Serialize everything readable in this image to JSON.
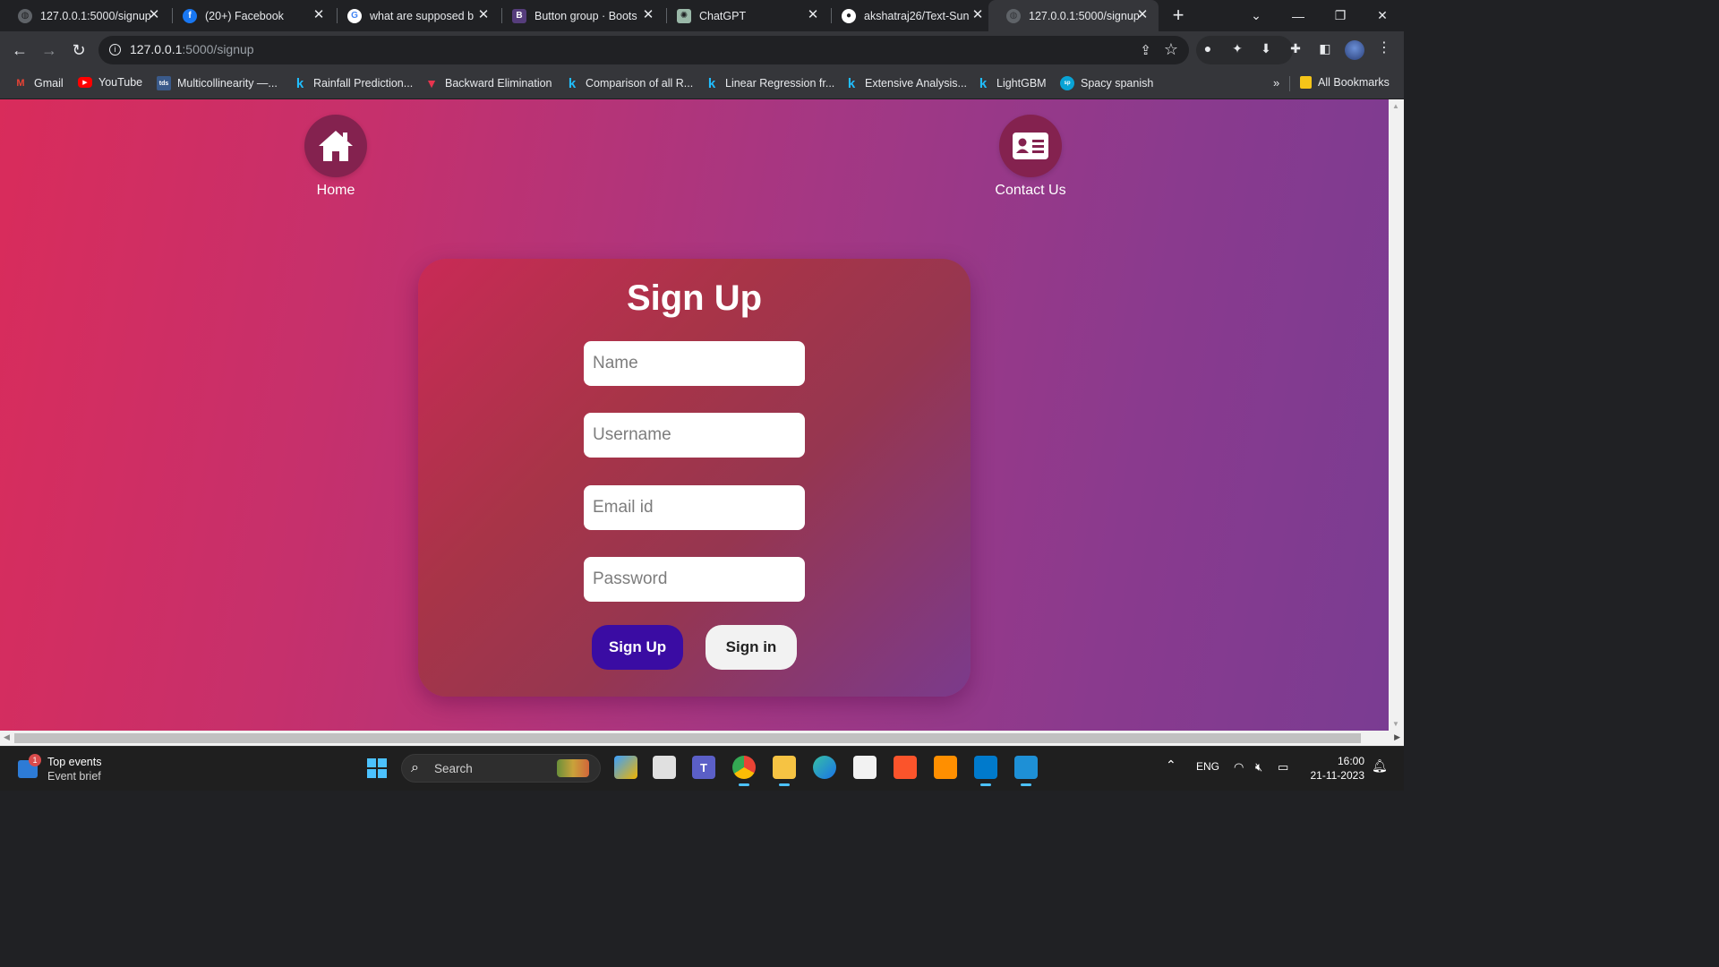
{
  "browser": {
    "tabs": [
      {
        "title": "127.0.0.1:5000/signup",
        "icon": "globe-icon"
      },
      {
        "title": "(20+) Facebook",
        "icon": "facebook-icon"
      },
      {
        "title": "what are supposed b",
        "icon": "google-icon"
      },
      {
        "title": "Button group · Boots",
        "icon": "bootstrap-icon"
      },
      {
        "title": "ChatGPT",
        "icon": "chatgpt-icon"
      },
      {
        "title": "akshatraj26/Text-Sun",
        "icon": "github-icon"
      },
      {
        "title": "127.0.0.1:5000/signup",
        "icon": "globe-icon"
      }
    ],
    "active_tab_index": 6,
    "url_host": "127.0.0.1",
    "url_path": ":5000/signup",
    "bookmarks": [
      {
        "label": "Gmail",
        "icon": "gmail-icon"
      },
      {
        "label": "YouTube",
        "icon": "youtube-icon"
      },
      {
        "label": "Multicollinearity —...",
        "icon": "tds-icon"
      },
      {
        "label": "Rainfall Prediction...",
        "icon": "kaggle-icon"
      },
      {
        "label": "Backward Elimination",
        "icon": "vertex-icon"
      },
      {
        "label": "Comparison of all R...",
        "icon": "kaggle-icon"
      },
      {
        "label": "Linear Regression fr...",
        "icon": "kaggle-icon"
      },
      {
        "label": "Extensive Analysis...",
        "icon": "kaggle-icon"
      },
      {
        "label": "LightGBM",
        "icon": "kaggle-icon"
      },
      {
        "label": "Spacy spanish",
        "icon": "spacy-icon"
      }
    ],
    "more_bookmarks": "»",
    "all_bookmarks": "All Bookmarks"
  },
  "page": {
    "nav": {
      "home_label": "Home",
      "contact_label": "Contact Us"
    },
    "form": {
      "title": "Sign Up",
      "name_placeholder": "Name",
      "username_placeholder": "Username",
      "email_placeholder": "Email id",
      "password_placeholder": "Password",
      "signup_label": "Sign Up",
      "signin_label": "Sign in"
    },
    "colors": {
      "gradient_start": "#d92c5b",
      "gradient_end": "#7a3c92",
      "icon_circle": "#84224f",
      "primary_button": "#3a0ca3",
      "secondary_button": "#f2f2f2"
    }
  },
  "taskbar": {
    "widget_title": "Top events",
    "widget_subtitle": "Event brief",
    "widget_badge": "1",
    "search_label": "Search",
    "language": "ENG",
    "time": "16:00",
    "date": "21-11-2023"
  }
}
